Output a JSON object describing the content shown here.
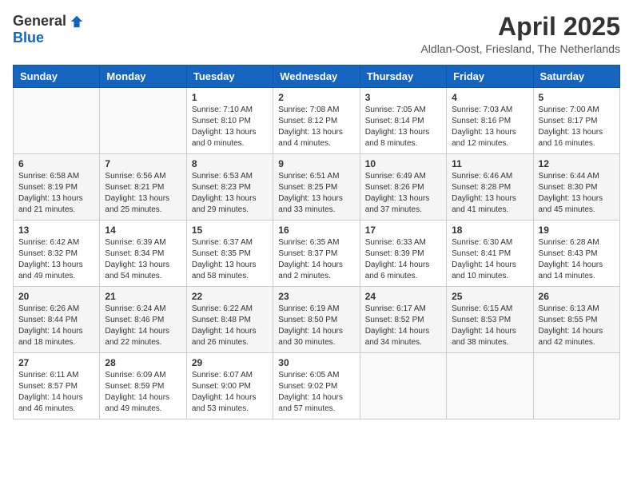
{
  "header": {
    "logo_general": "General",
    "logo_blue": "Blue",
    "month_title": "April 2025",
    "subtitle": "Aldlan-Oost, Friesland, The Netherlands"
  },
  "weekdays": [
    "Sunday",
    "Monday",
    "Tuesday",
    "Wednesday",
    "Thursday",
    "Friday",
    "Saturday"
  ],
  "weeks": [
    [
      {
        "day": "",
        "info": ""
      },
      {
        "day": "",
        "info": ""
      },
      {
        "day": "1",
        "info": "Sunrise: 7:10 AM\nSunset: 8:10 PM\nDaylight: 13 hours\nand 0 minutes."
      },
      {
        "day": "2",
        "info": "Sunrise: 7:08 AM\nSunset: 8:12 PM\nDaylight: 13 hours\nand 4 minutes."
      },
      {
        "day": "3",
        "info": "Sunrise: 7:05 AM\nSunset: 8:14 PM\nDaylight: 13 hours\nand 8 minutes."
      },
      {
        "day": "4",
        "info": "Sunrise: 7:03 AM\nSunset: 8:16 PM\nDaylight: 13 hours\nand 12 minutes."
      },
      {
        "day": "5",
        "info": "Sunrise: 7:00 AM\nSunset: 8:17 PM\nDaylight: 13 hours\nand 16 minutes."
      }
    ],
    [
      {
        "day": "6",
        "info": "Sunrise: 6:58 AM\nSunset: 8:19 PM\nDaylight: 13 hours\nand 21 minutes."
      },
      {
        "day": "7",
        "info": "Sunrise: 6:56 AM\nSunset: 8:21 PM\nDaylight: 13 hours\nand 25 minutes."
      },
      {
        "day": "8",
        "info": "Sunrise: 6:53 AM\nSunset: 8:23 PM\nDaylight: 13 hours\nand 29 minutes."
      },
      {
        "day": "9",
        "info": "Sunrise: 6:51 AM\nSunset: 8:25 PM\nDaylight: 13 hours\nand 33 minutes."
      },
      {
        "day": "10",
        "info": "Sunrise: 6:49 AM\nSunset: 8:26 PM\nDaylight: 13 hours\nand 37 minutes."
      },
      {
        "day": "11",
        "info": "Sunrise: 6:46 AM\nSunset: 8:28 PM\nDaylight: 13 hours\nand 41 minutes."
      },
      {
        "day": "12",
        "info": "Sunrise: 6:44 AM\nSunset: 8:30 PM\nDaylight: 13 hours\nand 45 minutes."
      }
    ],
    [
      {
        "day": "13",
        "info": "Sunrise: 6:42 AM\nSunset: 8:32 PM\nDaylight: 13 hours\nand 49 minutes."
      },
      {
        "day": "14",
        "info": "Sunrise: 6:39 AM\nSunset: 8:34 PM\nDaylight: 13 hours\nand 54 minutes."
      },
      {
        "day": "15",
        "info": "Sunrise: 6:37 AM\nSunset: 8:35 PM\nDaylight: 13 hours\nand 58 minutes."
      },
      {
        "day": "16",
        "info": "Sunrise: 6:35 AM\nSunset: 8:37 PM\nDaylight: 14 hours\nand 2 minutes."
      },
      {
        "day": "17",
        "info": "Sunrise: 6:33 AM\nSunset: 8:39 PM\nDaylight: 14 hours\nand 6 minutes."
      },
      {
        "day": "18",
        "info": "Sunrise: 6:30 AM\nSunset: 8:41 PM\nDaylight: 14 hours\nand 10 minutes."
      },
      {
        "day": "19",
        "info": "Sunrise: 6:28 AM\nSunset: 8:43 PM\nDaylight: 14 hours\nand 14 minutes."
      }
    ],
    [
      {
        "day": "20",
        "info": "Sunrise: 6:26 AM\nSunset: 8:44 PM\nDaylight: 14 hours\nand 18 minutes."
      },
      {
        "day": "21",
        "info": "Sunrise: 6:24 AM\nSunset: 8:46 PM\nDaylight: 14 hours\nand 22 minutes."
      },
      {
        "day": "22",
        "info": "Sunrise: 6:22 AM\nSunset: 8:48 PM\nDaylight: 14 hours\nand 26 minutes."
      },
      {
        "day": "23",
        "info": "Sunrise: 6:19 AM\nSunset: 8:50 PM\nDaylight: 14 hours\nand 30 minutes."
      },
      {
        "day": "24",
        "info": "Sunrise: 6:17 AM\nSunset: 8:52 PM\nDaylight: 14 hours\nand 34 minutes."
      },
      {
        "day": "25",
        "info": "Sunrise: 6:15 AM\nSunset: 8:53 PM\nDaylight: 14 hours\nand 38 minutes."
      },
      {
        "day": "26",
        "info": "Sunrise: 6:13 AM\nSunset: 8:55 PM\nDaylight: 14 hours\nand 42 minutes."
      }
    ],
    [
      {
        "day": "27",
        "info": "Sunrise: 6:11 AM\nSunset: 8:57 PM\nDaylight: 14 hours\nand 46 minutes."
      },
      {
        "day": "28",
        "info": "Sunrise: 6:09 AM\nSunset: 8:59 PM\nDaylight: 14 hours\nand 49 minutes."
      },
      {
        "day": "29",
        "info": "Sunrise: 6:07 AM\nSunset: 9:00 PM\nDaylight: 14 hours\nand 53 minutes."
      },
      {
        "day": "30",
        "info": "Sunrise: 6:05 AM\nSunset: 9:02 PM\nDaylight: 14 hours\nand 57 minutes."
      },
      {
        "day": "",
        "info": ""
      },
      {
        "day": "",
        "info": ""
      },
      {
        "day": "",
        "info": ""
      }
    ]
  ]
}
